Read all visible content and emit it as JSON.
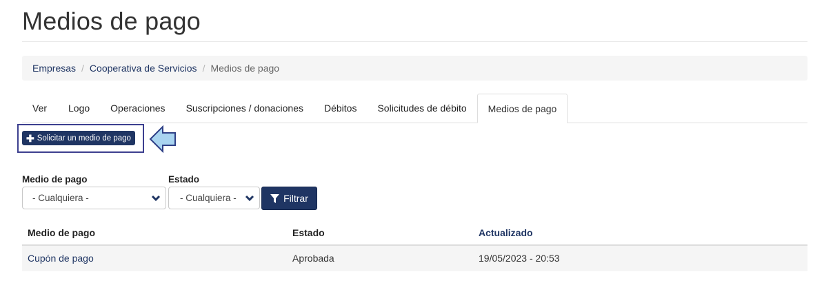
{
  "page": {
    "title": "Medios de pago"
  },
  "breadcrumb": [
    {
      "label": "Empresas"
    },
    {
      "label": "Cooperativa de Servicios"
    },
    {
      "label": "Medios de pago"
    }
  ],
  "breadcrumb_separator": "/",
  "tabs": [
    {
      "label": "Ver"
    },
    {
      "label": "Logo"
    },
    {
      "label": "Operaciones"
    },
    {
      "label": "Suscripciones / donaciones"
    },
    {
      "label": "Débitos"
    },
    {
      "label": "Solicitudes de débito"
    },
    {
      "label": "Medios de pago",
      "active": true
    }
  ],
  "actions": {
    "request_button": "Solicitar un medio de pago",
    "request_icon": "plus-icon"
  },
  "filters": {
    "medio": {
      "label": "Medio de pago",
      "value": "- Cualquiera -"
    },
    "estado": {
      "label": "Estado",
      "value": "- Cualquiera -"
    },
    "submit": "Filtrar",
    "submit_icon": "funnel-icon"
  },
  "table": {
    "columns": [
      "Medio de pago",
      "Estado",
      "Actualizado"
    ],
    "rows": [
      {
        "medio": "Cupón de pago",
        "estado": "Aprobada",
        "actualizado": "19/05/2023 - 20:53"
      }
    ]
  },
  "colors": {
    "primary": "#1f3563",
    "highlight_border": "#3c3f8f",
    "arrow_fill": "#a9d4f0",
    "arrow_stroke": "#2e3f86"
  }
}
